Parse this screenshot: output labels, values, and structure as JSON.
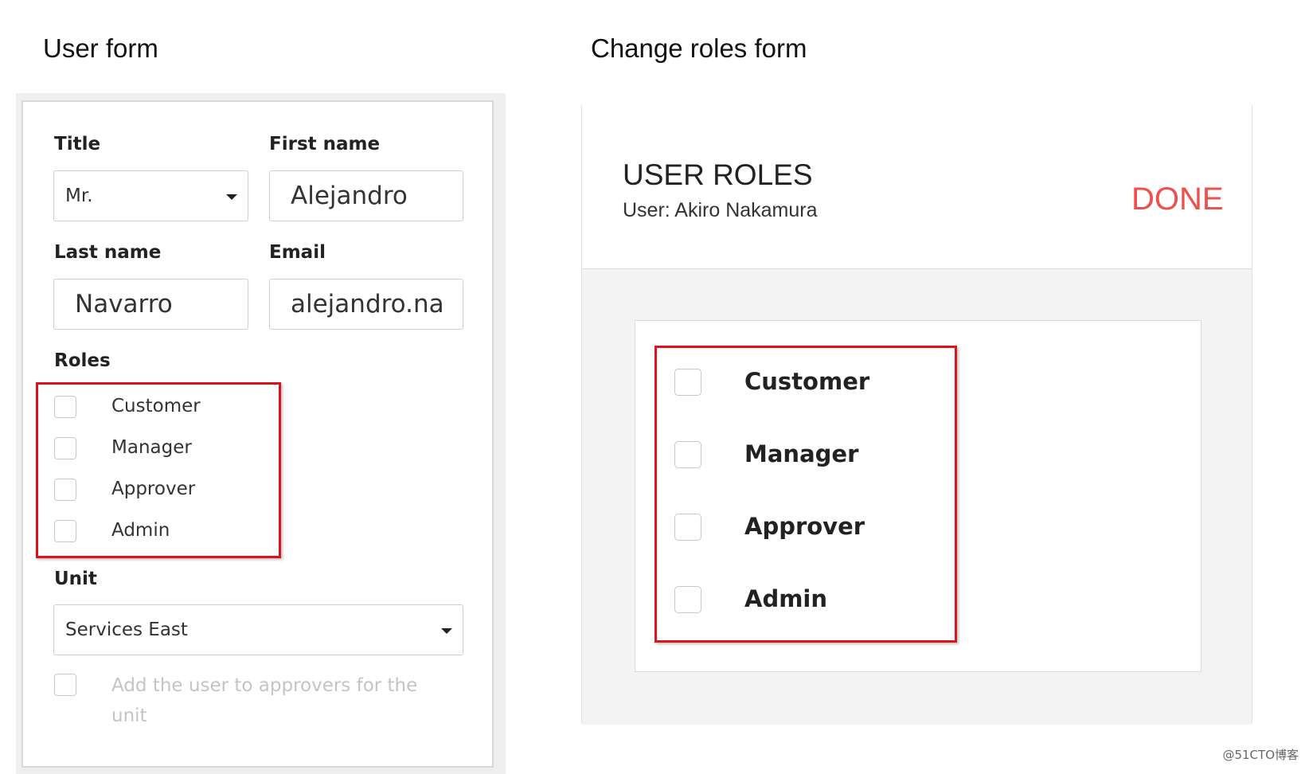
{
  "captions": {
    "left": "User form",
    "right": "Change roles form"
  },
  "user_form": {
    "title_label": "Title",
    "title_value": "Mr.",
    "first_name_label": "First name",
    "first_name_value": "Alejandro",
    "last_name_label": "Last name",
    "last_name_value": "Navarro",
    "email_label": "Email",
    "email_value": "alejandro.navarro",
    "roles_label": "Roles",
    "roles": [
      {
        "label": "Customer",
        "checked": false
      },
      {
        "label": "Manager",
        "checked": false
      },
      {
        "label": "Approver",
        "checked": false
      },
      {
        "label": "Admin",
        "checked": false
      }
    ],
    "unit_label": "Unit",
    "unit_value": "Services East",
    "approvers_label": "Add the user to approvers for the unit",
    "approvers_checked": false
  },
  "roles_form": {
    "heading": "USER ROLES",
    "user_line": "User: Akiro Nakamura",
    "done_label": "DONE",
    "roles": [
      {
        "label": "Customer",
        "checked": false
      },
      {
        "label": "Manager",
        "checked": false
      },
      {
        "label": "Approver",
        "checked": false
      },
      {
        "label": "Admin",
        "checked": false
      }
    ]
  },
  "colors": {
    "accent": "#f0504d",
    "highlight": "#d9141d"
  },
  "icons": {
    "dropdown": "caret-down-icon"
  },
  "watermark": "@51CTO博客"
}
